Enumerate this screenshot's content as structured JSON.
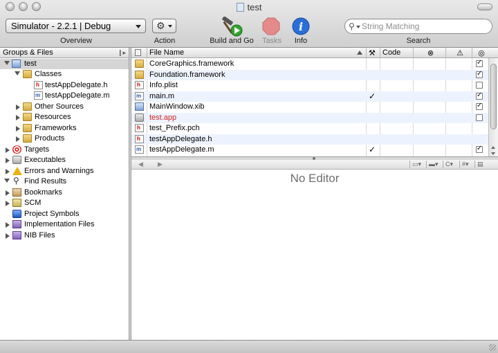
{
  "window": {
    "title": "test"
  },
  "toolbar": {
    "scheme_popup": "Simulator - 2.2.1 | Debug",
    "overview_label": "Overview",
    "action_label": "Action",
    "build_go_label": "Build and Go",
    "tasks_label": "Tasks",
    "info_label": "Info",
    "search_label": "Search",
    "search_placeholder": "String Matching"
  },
  "sidebar": {
    "header": "Groups & Files",
    "items": [
      {
        "label": "test",
        "icon": "project-icon"
      },
      {
        "label": "Classes",
        "icon": "folder-icon"
      },
      {
        "label": "testAppDelegate.h",
        "icon": "header-file-icon"
      },
      {
        "label": "testAppDelegate.m",
        "icon": "source-file-icon"
      },
      {
        "label": "Other Sources",
        "icon": "folder-icon"
      },
      {
        "label": "Resources",
        "icon": "folder-icon"
      },
      {
        "label": "Frameworks",
        "icon": "folder-icon"
      },
      {
        "label": "Products",
        "icon": "folder-icon"
      },
      {
        "label": "Targets",
        "icon": "target-icon"
      },
      {
        "label": "Executables",
        "icon": "executable-icon"
      },
      {
        "label": "Errors and Warnings",
        "icon": "warning-icon"
      },
      {
        "label": "Find Results",
        "icon": "magnifier-icon"
      },
      {
        "label": "Bookmarks",
        "icon": "bookmark-icon"
      },
      {
        "label": "SCM",
        "icon": "scm-icon"
      },
      {
        "label": "Project Symbols",
        "icon": "symbols-icon"
      },
      {
        "label": "Implementation Files",
        "icon": "smart-group-icon"
      },
      {
        "label": "NIB Files",
        "icon": "smart-group-icon"
      }
    ]
  },
  "filelist": {
    "headers": {
      "file_name": "File Name",
      "code": "Code"
    },
    "rows": [
      {
        "name": "CoreGraphics.framework",
        "icon": "framework-icon",
        "built": "",
        "target": true
      },
      {
        "name": "Foundation.framework",
        "icon": "framework-icon",
        "built": "",
        "target": true
      },
      {
        "name": "Info.plist",
        "icon": "plist-icon",
        "built": "",
        "target": false
      },
      {
        "name": "main.m",
        "icon": "source-file-icon",
        "built": "✓",
        "target": true
      },
      {
        "name": "MainWindow.xib",
        "icon": "xib-icon",
        "built": "",
        "target": true
      },
      {
        "name": "test.app",
        "icon": "app-icon",
        "built": "",
        "target": false,
        "color": "#d42020"
      },
      {
        "name": "test_Prefix.pch",
        "icon": "header-file-icon",
        "built": "",
        "target": null
      },
      {
        "name": "testAppDelegate.h",
        "icon": "header-file-icon",
        "built": "",
        "target": null
      },
      {
        "name": "testAppDelegate.m",
        "icon": "source-file-icon",
        "built": "✓",
        "target": true
      }
    ]
  },
  "editor": {
    "placeholder": "No Editor"
  }
}
